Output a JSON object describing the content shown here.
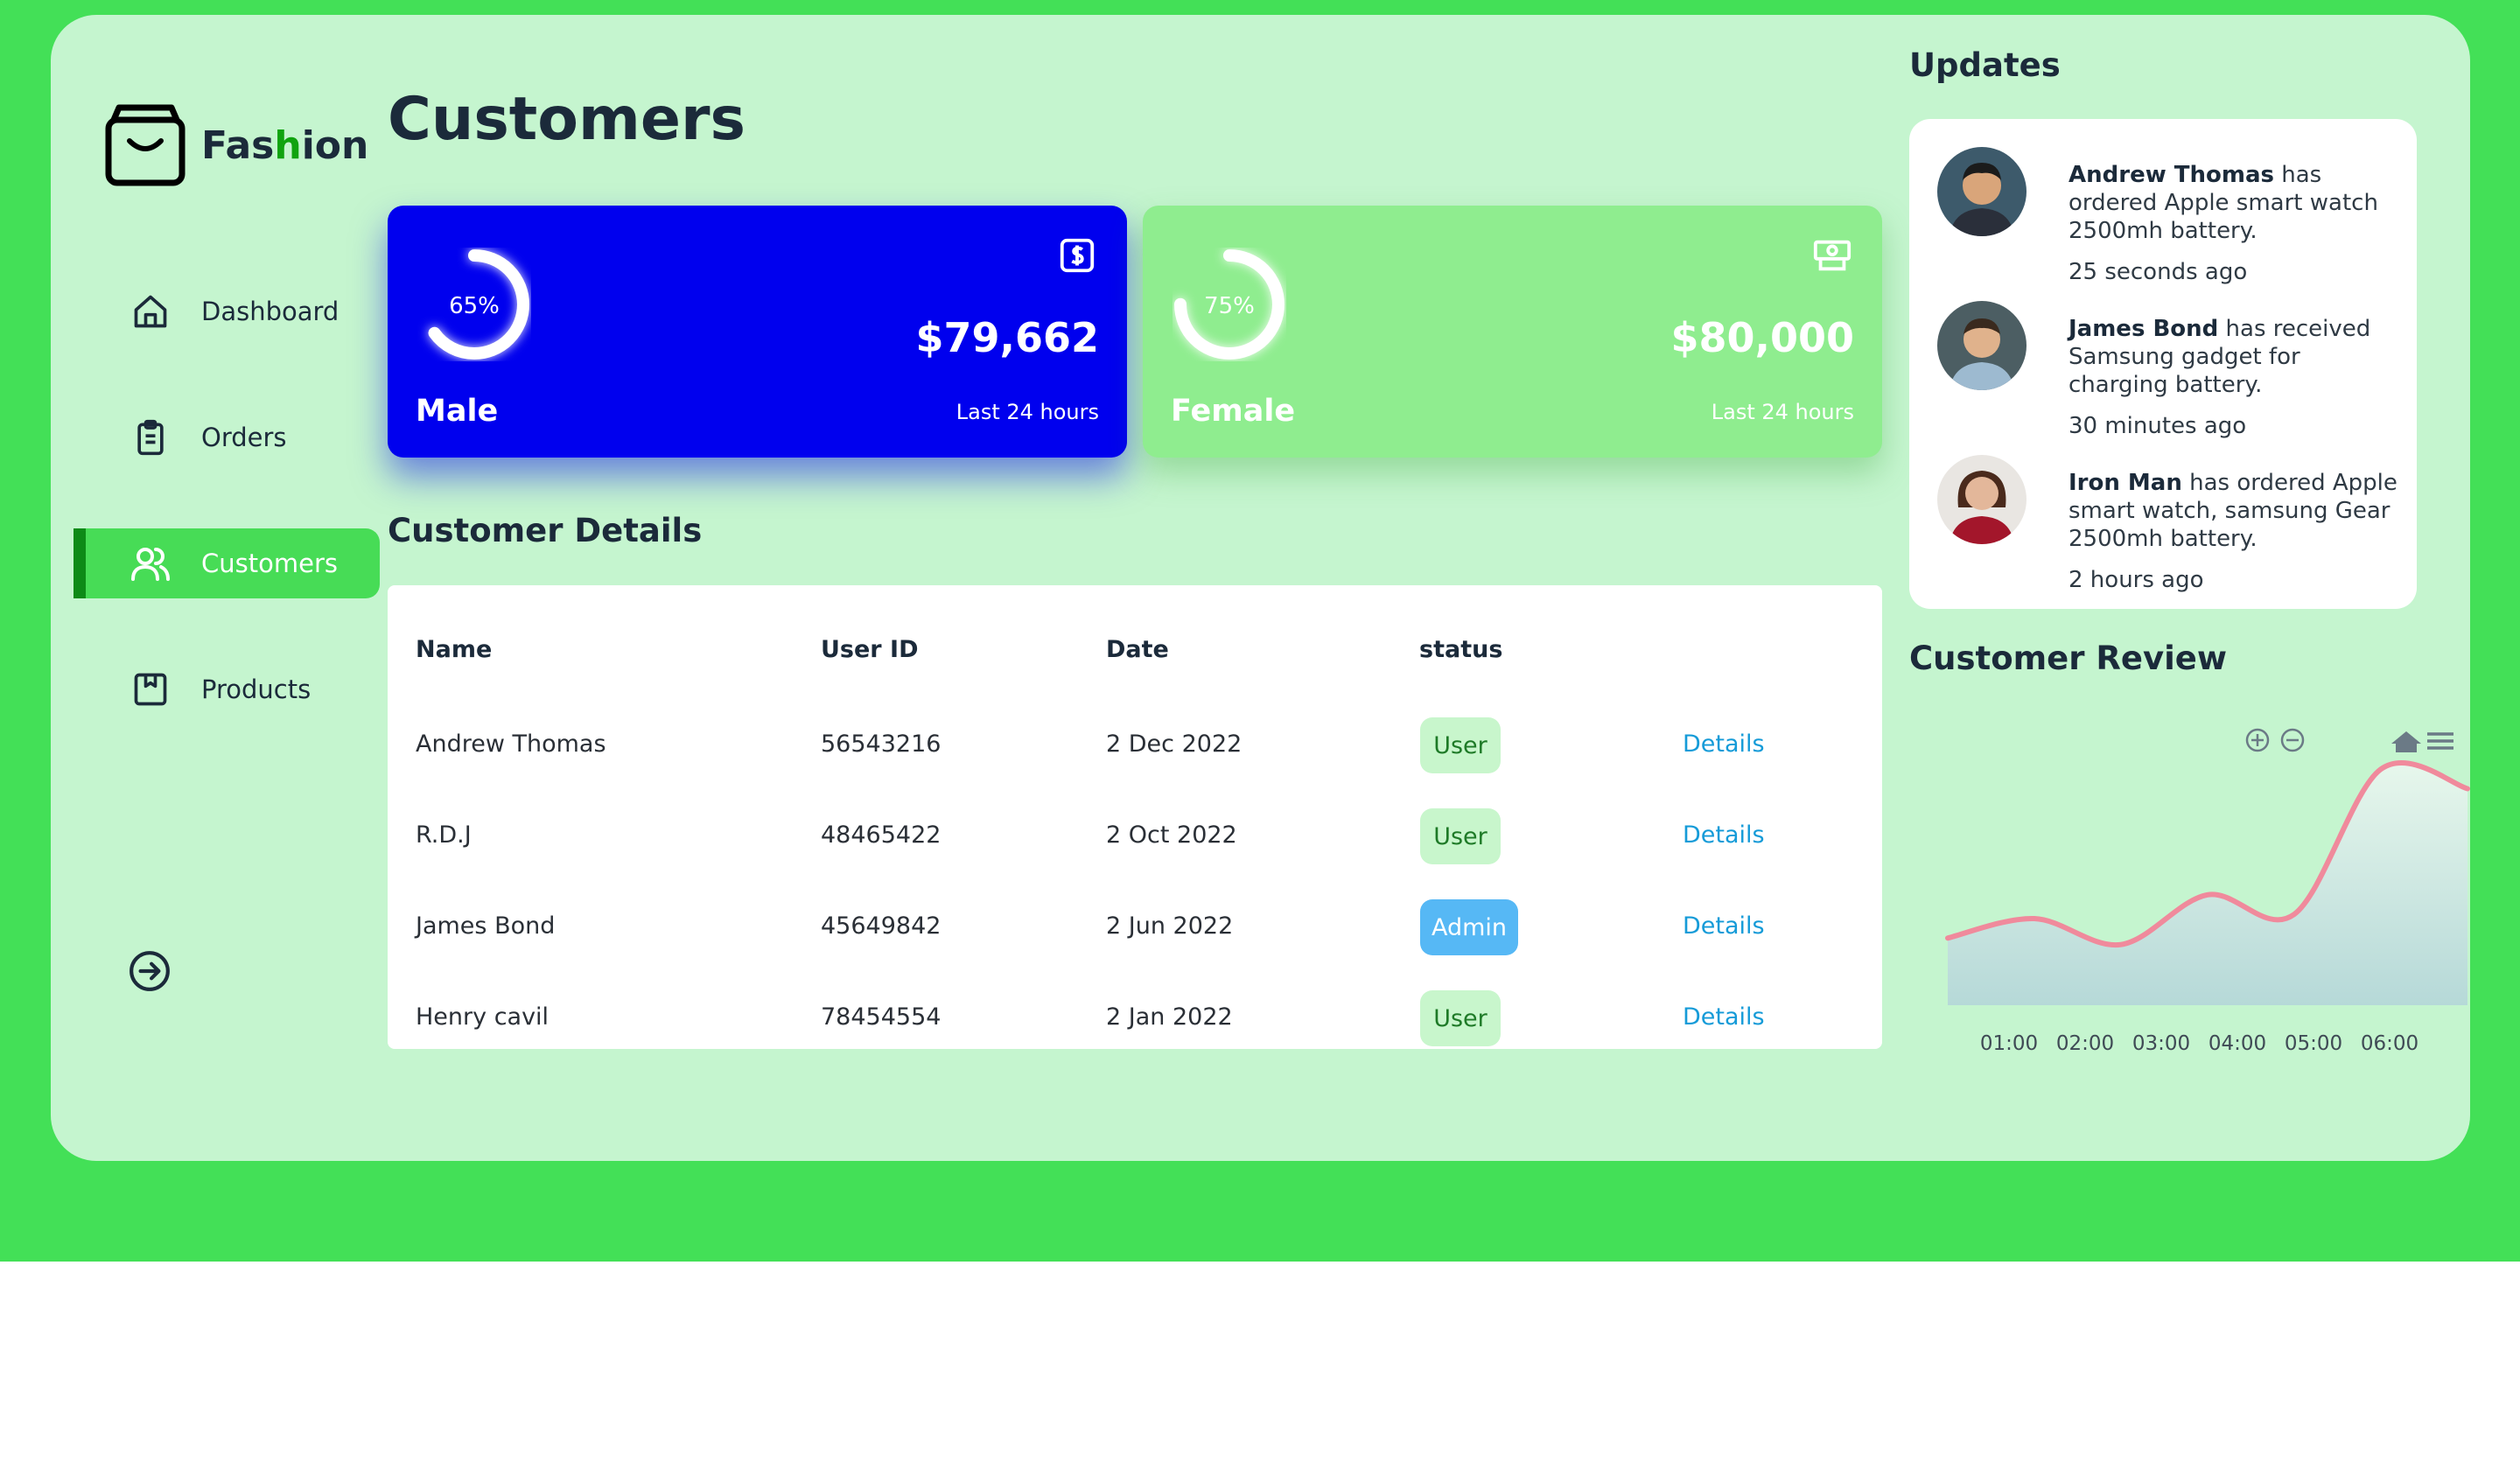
{
  "brand": {
    "name_prefix": "Fas",
    "name_accent": "h",
    "name_suffix": "ion"
  },
  "sidebar": {
    "items": [
      {
        "label": "Dashboard",
        "icon": "home-icon",
        "active": false
      },
      {
        "label": "Orders",
        "icon": "clipboard-icon",
        "active": false
      },
      {
        "label": "Customers",
        "icon": "users-icon",
        "active": true
      },
      {
        "label": "Products",
        "icon": "package-icon",
        "active": false
      }
    ],
    "logout_icon": "sign-out-icon"
  },
  "main": {
    "title": "Customers",
    "cards": [
      {
        "label": "Male",
        "percent": "65%",
        "percent_value": 65,
        "value": "$79,662",
        "sub": "Last 24 hours",
        "icon": "dollar-icon",
        "color": "#0000ee"
      },
      {
        "label": "Female",
        "percent": "75%",
        "percent_value": 75,
        "value": "$80,000",
        "sub": "Last 24 hours",
        "icon": "money-icon",
        "color": "#8fed8f"
      }
    ],
    "details_title": "Customer Details",
    "table": {
      "headers": [
        "Name",
        "User ID",
        "Date",
        "status"
      ],
      "rows": [
        {
          "name": "Andrew Thomas",
          "user_id": "56543216",
          "date": "2 Dec 2022",
          "status": "User",
          "action": "Details"
        },
        {
          "name": "R.D.J",
          "user_id": "48465422",
          "date": "2 Oct 2022",
          "status": "User",
          "action": "Details"
        },
        {
          "name": "James Bond",
          "user_id": "45649842",
          "date": "2 Jun 2022",
          "status": "Admin",
          "action": "Details"
        },
        {
          "name": "Henry cavil",
          "user_id": "78454554",
          "date": "2 Jan 2022",
          "status": "User",
          "action": "Details"
        }
      ]
    }
  },
  "updates": {
    "title": "Updates",
    "items": [
      {
        "name": "Andrew Thomas",
        "text": " has ordered Apple smart watch 2500mh battery.",
        "time": "25 seconds ago"
      },
      {
        "name": "James Bond",
        "text": " has received Samsung gadget for charging battery.",
        "time": "30 minutes ago"
      },
      {
        "name": "Iron Man",
        "text": " has ordered Apple smart watch, samsung Gear 2500mh battery.",
        "time": "2 hours ago"
      }
    ]
  },
  "review": {
    "title": "Customer Review",
    "chart_data": {
      "type": "area",
      "x": [
        "01:00",
        "02:00",
        "03:00",
        "04:00",
        "05:00",
        "06:00"
      ],
      "series": [
        {
          "values": [
            31,
            40,
            28,
            51,
            42,
            109,
            100
          ]
        }
      ],
      "line_color": "#f08a9c",
      "fill_color": "#b8dcd6",
      "grid": false,
      "toolbar_icons": [
        "zoom-in-icon",
        "zoom-out-icon",
        "reset-home-icon",
        "menu-icon"
      ]
    }
  }
}
